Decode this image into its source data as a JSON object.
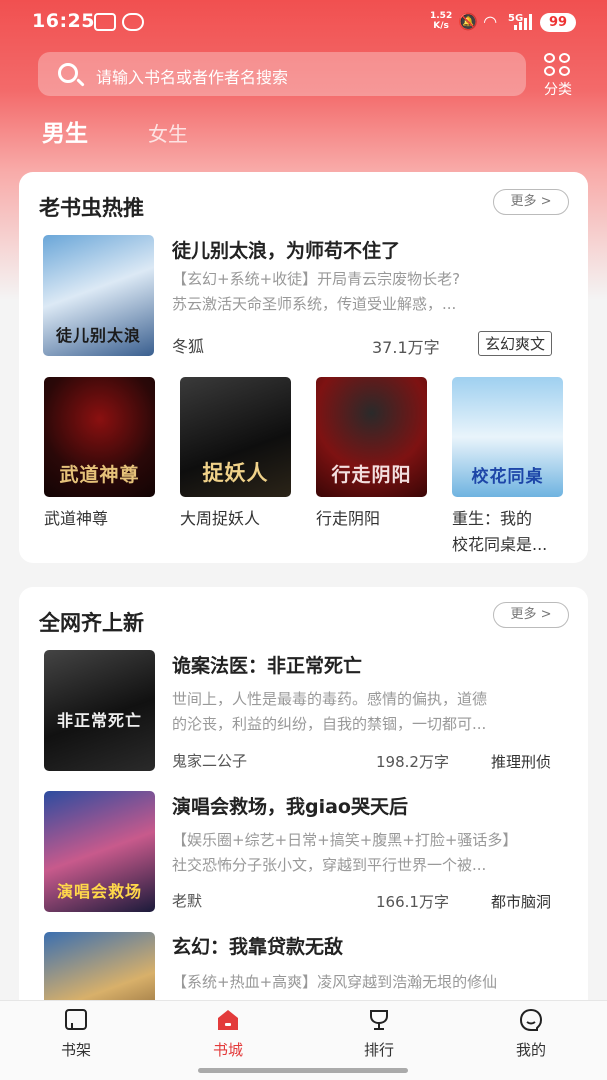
{
  "status_bar": {
    "time": "16:25",
    "network_speed": "1.52",
    "network_unit": "K/s",
    "signal": "5G",
    "battery": "99"
  },
  "search": {
    "placeholder": "请输入书名或者作者名搜索",
    "category_label": "分类"
  },
  "gender_tabs": [
    {
      "label": "男生",
      "active": true
    },
    {
      "label": "女生",
      "active": false
    }
  ],
  "section_hot": {
    "title": "老书虫热推",
    "more_label": "更多 >",
    "featured": {
      "title": "徒儿别太浪，为师苟不住了",
      "desc_line1": "【玄幻+系统+收徒】开局青云宗废物长老?",
      "desc_line2": "苏云激活天命圣师系统，传道受业解惑，...",
      "author": "冬狐",
      "word_count": "37.1万字",
      "tag": "玄幻爽文",
      "cover_text": "徒儿别太浪"
    },
    "grid": [
      {
        "title": "武道神尊",
        "cover_text": "武道神尊"
      },
      {
        "title": "大周捉妖人",
        "cover_text": "捉妖人"
      },
      {
        "title": "行走阴阳",
        "cover_text": "行走阴阳"
      },
      {
        "title_line1": "重生：我的",
        "title_line2": "校花同桌是...",
        "cover_text": "校花同桌"
      }
    ]
  },
  "section_new": {
    "title": "全网齐上新",
    "more_label": "更多 >",
    "books": [
      {
        "title": "诡案法医：非正常死亡",
        "desc_line1": "世间上，人性是最毒的毒药。感情的偏执，道德",
        "desc_line2": "的沦丧，利益的纠纷，自我的禁锢，一切都可...",
        "author": "鬼家二公子",
        "word_count": "198.2万字",
        "tag": "推理刑侦",
        "cover_text": "非正常死亡"
      },
      {
        "title": "演唱会救场，我giao哭天后",
        "desc_line1": "【娱乐圈+综艺+日常+搞笑+腹黑+打脸+骚话多】",
        "desc_line2": "社交恐怖分子张小文，穿越到平行世界一个被...",
        "author": "老默",
        "word_count": "166.1万字",
        "tag": "都市脑洞",
        "cover_text": "演唱会救场"
      },
      {
        "title": "玄幻：我靠贷款无敌",
        "desc_line1": "【系统+热血+高爽】凌风穿越到浩瀚无垠的修仙",
        "desc_line2": "",
        "cover_text": ""
      }
    ]
  },
  "bottom_nav": [
    {
      "label": "书架",
      "active": false
    },
    {
      "label": "书城",
      "active": true
    },
    {
      "label": "排行",
      "active": false
    },
    {
      "label": "我的",
      "active": false
    }
  ],
  "colors": {
    "brand": "#e94848",
    "active_tab": "#e33b3b",
    "tag_text": "#333333"
  }
}
